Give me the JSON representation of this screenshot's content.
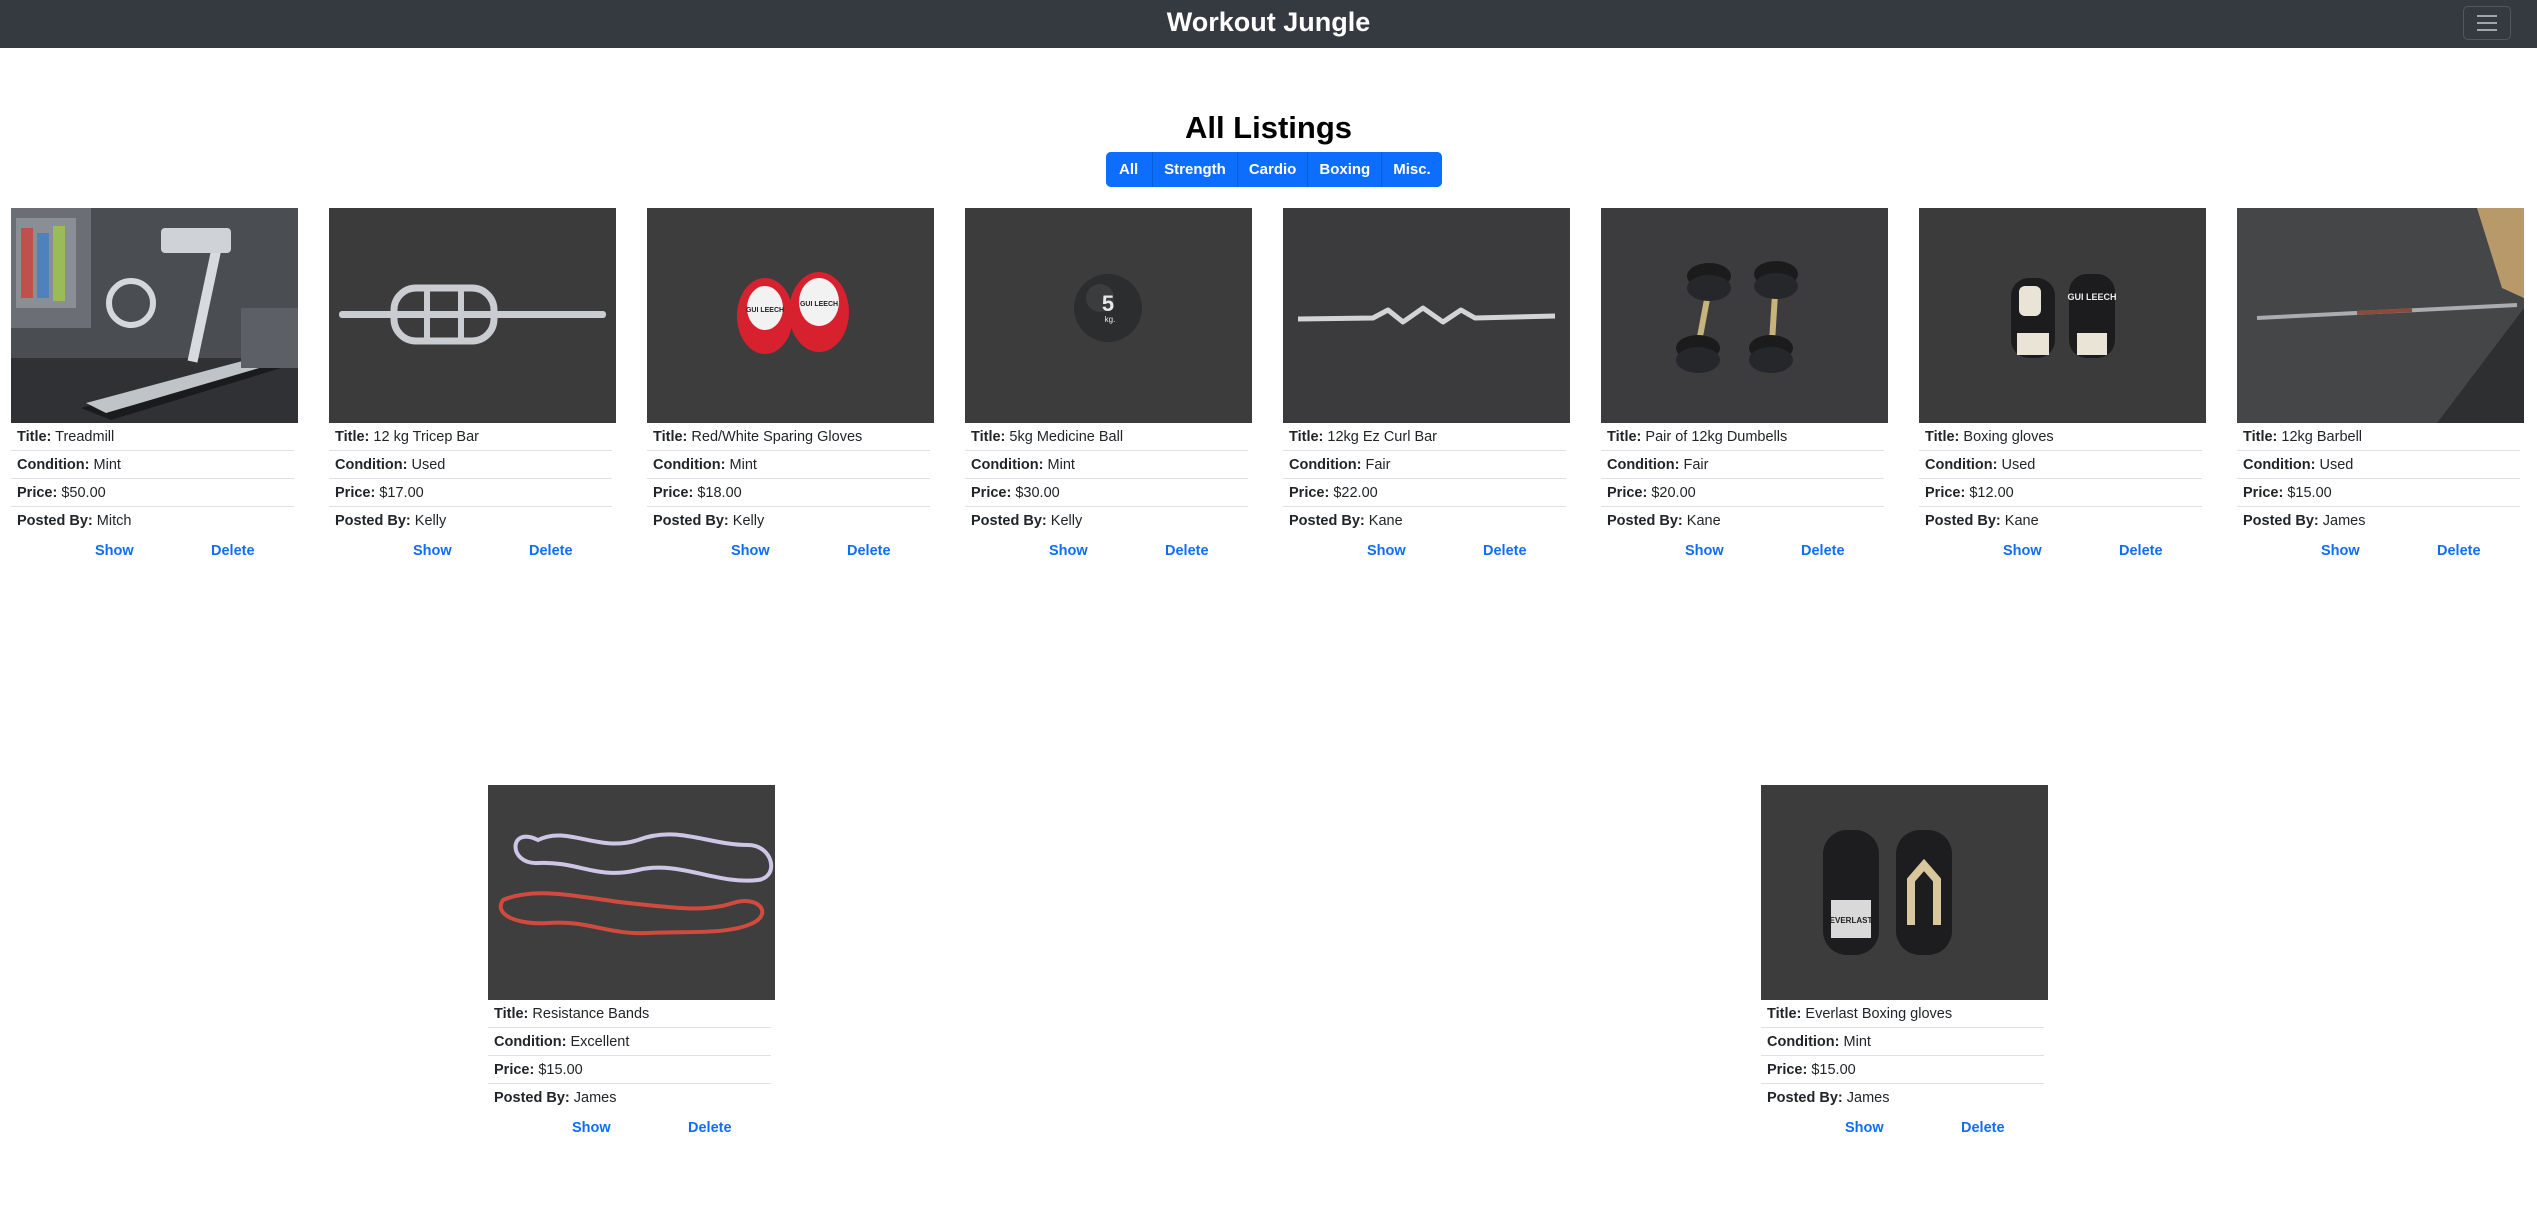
{
  "navbar": {
    "brand": "Workout Jungle",
    "menu_icon": "hamburger-menu-icon"
  },
  "page": {
    "title": "All Listings"
  },
  "filters": [
    "All",
    "Strength",
    "Cardio",
    "Boxing",
    "Misc."
  ],
  "labels": {
    "title": "Title:",
    "condition": "Condition:",
    "price": "Price:",
    "posted_by": "Posted By:",
    "show": "Show",
    "delete": "Delete"
  },
  "listings": [
    {
      "title": "Treadmill",
      "condition": "Mint",
      "price": "$50.00",
      "posted_by": "Mitch"
    },
    {
      "title": "12 kg Tricep Bar",
      "condition": "Used",
      "price": "$17.00",
      "posted_by": "Kelly"
    },
    {
      "title": "Red/White Sparing Gloves",
      "condition": "Mint",
      "price": "$18.00",
      "posted_by": "Kelly"
    },
    {
      "title": "5kg Medicine Ball",
      "condition": "Mint",
      "price": "$30.00",
      "posted_by": "Kelly"
    },
    {
      "title": "12kg Ez Curl Bar",
      "condition": "Fair",
      "price": "$22.00",
      "posted_by": "Kane"
    },
    {
      "title": "Pair of 12kg Dumbells",
      "condition": "Fair",
      "price": "$20.00",
      "posted_by": "Kane"
    },
    {
      "title": "Boxing gloves",
      "condition": "Used",
      "price": "$12.00",
      "posted_by": "Kane"
    },
    {
      "title": "12kg Barbell",
      "condition": "Used",
      "price": "$15.00",
      "posted_by": "James"
    },
    {
      "title": "Resistance Bands",
      "condition": "Excellent",
      "price": "$15.00",
      "posted_by": "James"
    },
    {
      "title": "Everlast Boxing gloves",
      "condition": "Mint",
      "price": "$15.00",
      "posted_by": "James"
    }
  ],
  "image_text": {
    "pads_brand": "GUI LEECH",
    "ball_weight": "5",
    "ball_unit": "kg.",
    "gloves_brand": "GUI LEECH",
    "everlast_brand": "EVERLAST"
  }
}
